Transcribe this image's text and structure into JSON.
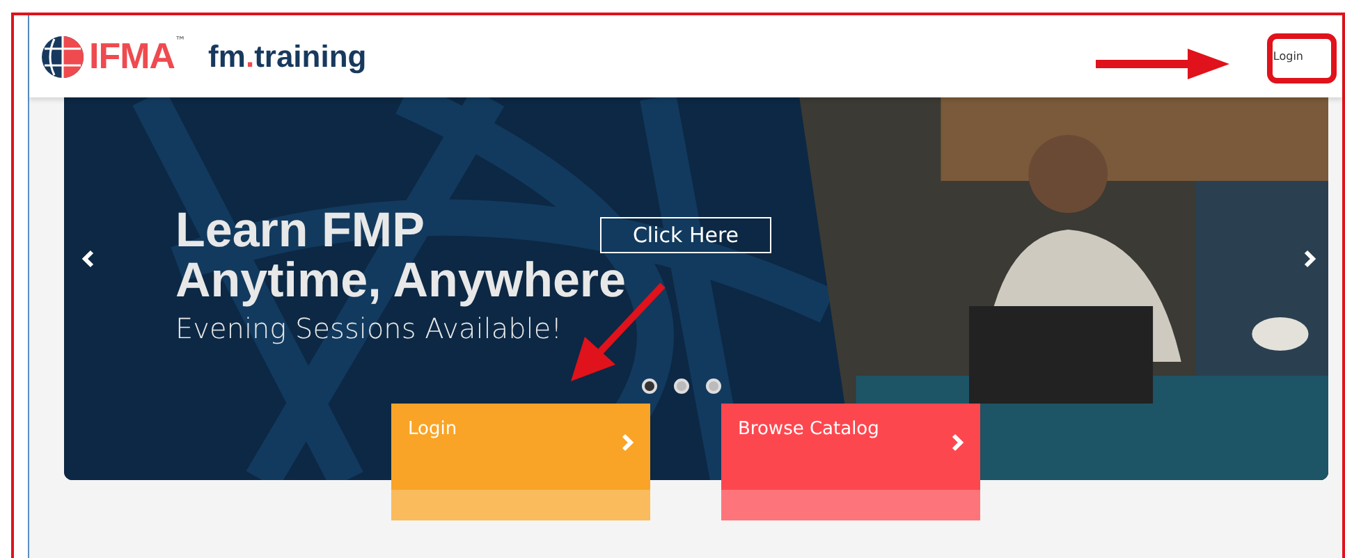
{
  "header": {
    "logo_text": "IFMA",
    "logo_mark": "™",
    "site_name_parts": [
      "fm",
      ".",
      "training"
    ],
    "login_link": "Login"
  },
  "carousel": {
    "headline": [
      "Learn FMP",
      "Anytime, Anywhere"
    ],
    "subtitle": "Evening Sessions Available!",
    "cta": "Click Here",
    "dots": [
      {
        "selected": true
      },
      {
        "selected": false
      },
      {
        "selected": false
      }
    ]
  },
  "cards": [
    {
      "label": "Login",
      "color": "#f9a426"
    },
    {
      "label": "Browse Catalog",
      "color": "#fd474f"
    }
  ]
}
